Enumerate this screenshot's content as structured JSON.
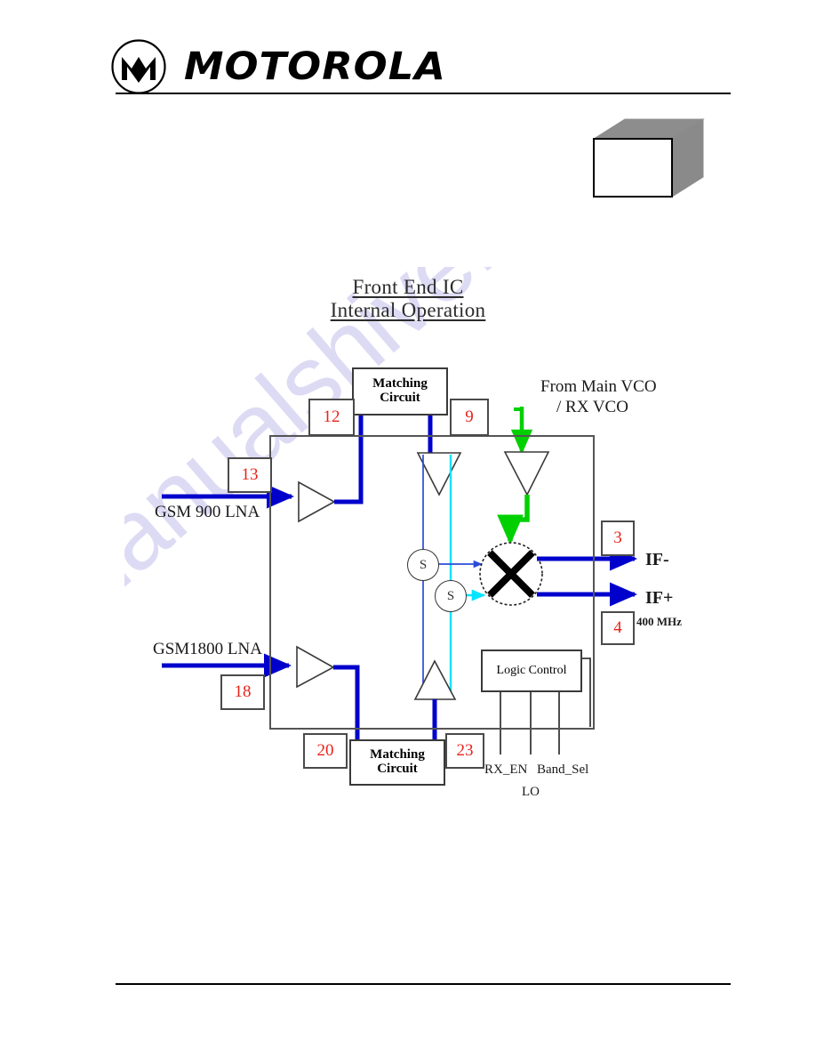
{
  "header": {
    "brand": "MOTOROLA",
    "logo_icon": "motorola-m-logo-icon"
  },
  "diagram": {
    "title_line1": "Front End IC",
    "title_line2": "Internal Operation",
    "blocks": {
      "matching_top_line1": "Matching",
      "matching_top_line2": "Circuit",
      "matching_bottom_line1": "Matching",
      "matching_bottom_line2": "Circuit",
      "logic_control": "Logic Control"
    },
    "pins": {
      "p12": "12",
      "p9": "9",
      "p13": "13",
      "p18": "18",
      "p20": "20",
      "p23": "23",
      "p3": "3",
      "p4": "4"
    },
    "labels": {
      "gsm900_lna": "GSM 900 LNA",
      "gsm1800_lna": "GSM1800 LNA",
      "vco_line1": "From Main VCO",
      "vco_line2": "/ RX VCO",
      "if_minus": "IF-",
      "if_plus": "IF+",
      "if_freq": "400 MHz",
      "rx_en": "RX_EN",
      "band_sel": "Band_Sel",
      "lo": "LO"
    },
    "switches": {
      "s1": "S",
      "s2": "S"
    },
    "colors": {
      "signal_blue": "#0000cc",
      "lo_green": "#00d000",
      "pin_red": "#e8231a",
      "switch_cyan": "#00e5ff",
      "box_gray": "#555555"
    }
  },
  "watermark": {
    "text": "manualshive.com"
  }
}
